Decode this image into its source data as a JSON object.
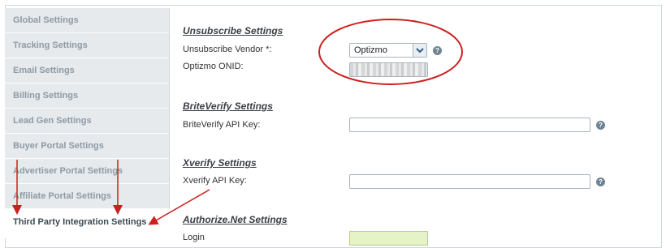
{
  "sidebar": {
    "items": [
      {
        "label": "Global Settings"
      },
      {
        "label": "Tracking Settings"
      },
      {
        "label": "Email Settings"
      },
      {
        "label": "Billing Settings"
      },
      {
        "label": "Lead Gen Settings"
      },
      {
        "label": "Buyer Portal Settings"
      },
      {
        "label": "Advertiser Portal Settings"
      },
      {
        "label": "Affiliate Portal Settings"
      },
      {
        "label": "Third Party Integration Settings",
        "active": true
      }
    ]
  },
  "sections": {
    "unsubscribe": {
      "title": "Unsubscribe Settings",
      "vendor_label": "Unsubscribe Vendor *:",
      "vendor_value": "Optizmo",
      "onid_label": "Optizmo ONID:"
    },
    "briteverify": {
      "title": "BriteVerify Settings",
      "api_key_label": "BriteVerify API Key:",
      "api_key_value": ""
    },
    "xverify": {
      "title": "Xverify Settings",
      "api_key_label": "Xverify API Key:",
      "api_key_value": ""
    },
    "authorize": {
      "title": "Authorize.Net Settings",
      "login_label": "Login"
    }
  },
  "help_glyph": "?",
  "annotation_color": "#cc1f1f"
}
